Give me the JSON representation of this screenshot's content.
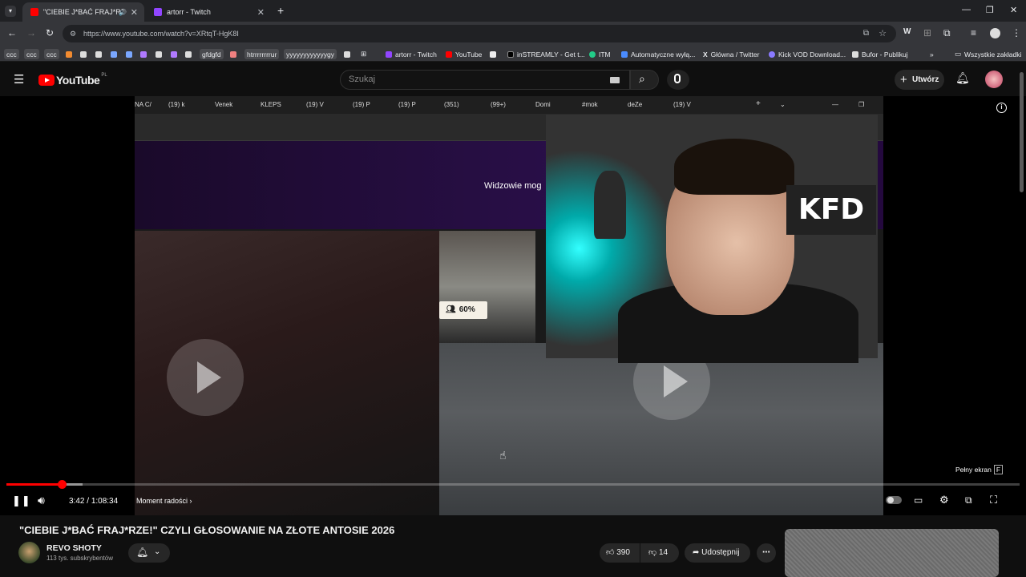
{
  "browser": {
    "tabs": [
      {
        "label": "\"CIEBIE J*BAĆ FRAJ*RZE!\" C",
        "active": true
      },
      {
        "label": "artorr - Twitch",
        "active": false
      }
    ],
    "url": "https://www.youtube.com/watch?v=XRtqT-HgK8I",
    "bookmarks": [
      "ccc",
      "ccc",
      "ccc",
      "gfdgfd",
      "htrrrrrrrrur",
      "yyyyyyyyyyyygy",
      "artorr - Twitch",
      "YouTube",
      "inSTREAMLY - Get t...",
      "ITM",
      "Automatyczne wyłą...",
      "Główna / Twitter",
      "Kick VOD Download...",
      "Bufor - Publikuj",
      "Wszystkie zakładki"
    ]
  },
  "youtube": {
    "logo": "YouTube",
    "region": "PL",
    "search_placeholder": "Szukaj",
    "create_label": "Utwórz"
  },
  "video": {
    "inner_tabs": [
      "NA C/",
      "(19) k",
      "Venek",
      "KLEPS",
      "(19) V",
      "(19) P",
      "(19) P",
      "(351)",
      "(99+)",
      "Domi",
      "#mok",
      "deZe",
      "(19) V"
    ],
    "overlay_text": "Widzowie mog",
    "kfd_sign": "KFD",
    "poll_percent": "60%",
    "progress_fraction": 0.0542,
    "buffer_fraction": 0.075,
    "time_current": "3:42",
    "time_total": "1:08:34",
    "chapter": "Moment radości",
    "fullscreen_label": "Pełny ekran",
    "fullscreen_key": "F"
  },
  "meta": {
    "title": "\"CIEBIE J*BAĆ FRAJ*RZE!\" CZYLI GŁOSOWANIE NA ZŁOTE ANTOSIE 2026",
    "channel": "REVO SHOTY",
    "subscribers": "113 tys. subskrybentów",
    "likes": "390",
    "dislikes": "14",
    "share_label": "Udostępnij"
  }
}
